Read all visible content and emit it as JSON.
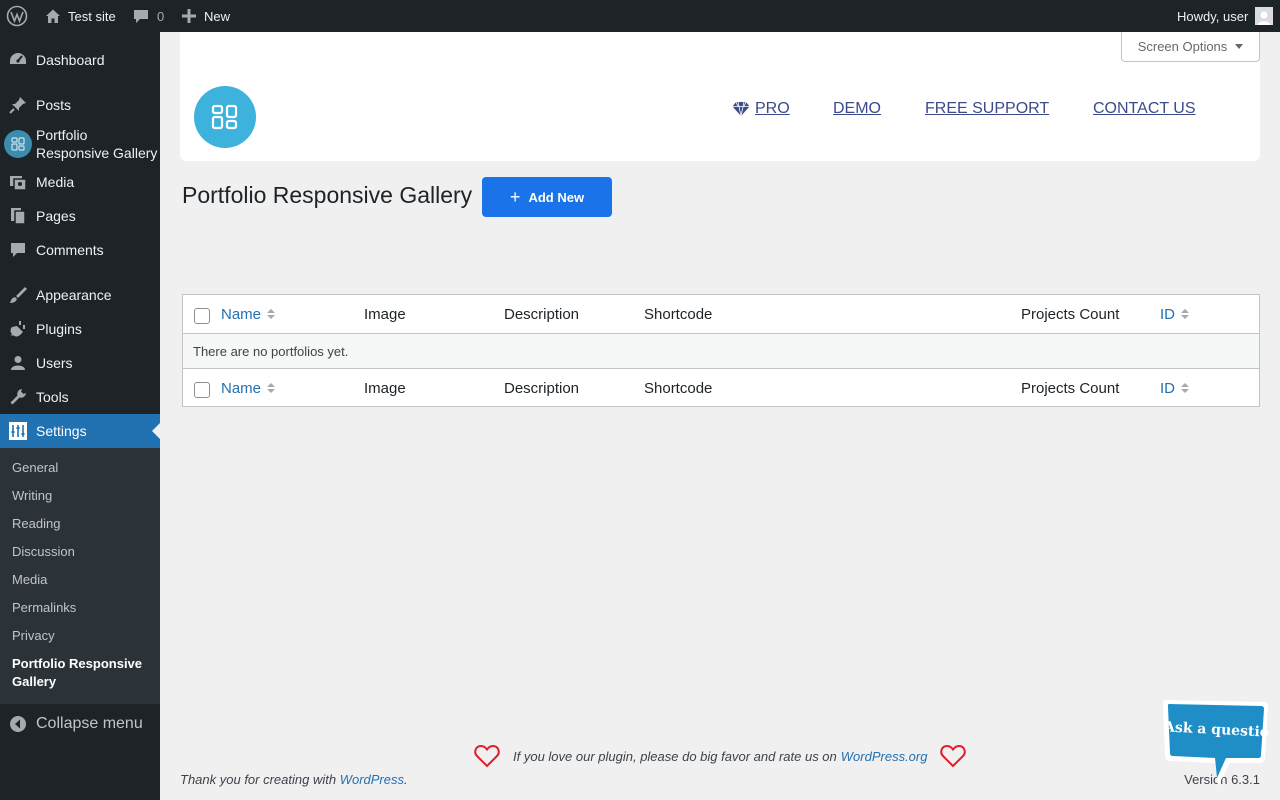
{
  "adminbar": {
    "site_name": "Test site",
    "comments_count": "0",
    "new_label": "New",
    "howdy": "Howdy, user"
  },
  "sidebar": {
    "items": [
      {
        "label": "Dashboard",
        "icon": "dashboard-icon"
      },
      {
        "label": "Posts",
        "icon": "pin-icon"
      },
      {
        "label": "Portfolio Responsive Gallery",
        "icon": "gallery-grid-icon"
      },
      {
        "label": "Media",
        "icon": "media-icon"
      },
      {
        "label": "Pages",
        "icon": "pages-icon"
      },
      {
        "label": "Comments",
        "icon": "comment-icon"
      },
      {
        "label": "Appearance",
        "icon": "brush-icon"
      },
      {
        "label": "Plugins",
        "icon": "plugin-icon"
      },
      {
        "label": "Users",
        "icon": "user-icon"
      },
      {
        "label": "Tools",
        "icon": "wrench-icon"
      },
      {
        "label": "Settings",
        "icon": "settings-sliders-icon"
      }
    ],
    "submenu": [
      "General",
      "Writing",
      "Reading",
      "Discussion",
      "Media",
      "Permalinks",
      "Privacy",
      "Portfolio Responsive Gallery"
    ],
    "collapse_label": "Collapse menu"
  },
  "header": {
    "screen_options": "Screen Options",
    "links": {
      "pro": "PRO",
      "demo": "DEMO",
      "support": "FREE SUPPORT",
      "contact": "CONTACT US"
    }
  },
  "page": {
    "title": "Portfolio Responsive Gallery",
    "add_new": "Add New"
  },
  "table": {
    "columns": {
      "name": "Name",
      "image": "Image",
      "description": "Description",
      "shortcode": "Shortcode",
      "projects_count": "Projects Count",
      "id": "ID"
    },
    "empty_message": "There are no portfolios yet."
  },
  "footer": {
    "rate_text": "If you love our plugin, please do big favor and rate us on ",
    "rate_link": "WordPress.org",
    "thanks_text": "Thank you for creating with ",
    "thanks_link": "WordPress",
    "thanks_end": ".",
    "version": "Version 6.3.1"
  },
  "ask_bubble": "Ask a question",
  "colors": {
    "accent": "#2271b1",
    "admin_dark": "#1d2327",
    "add_button": "#1a73e8",
    "logo": "#3db2dc",
    "heart": "#e11d2a"
  }
}
